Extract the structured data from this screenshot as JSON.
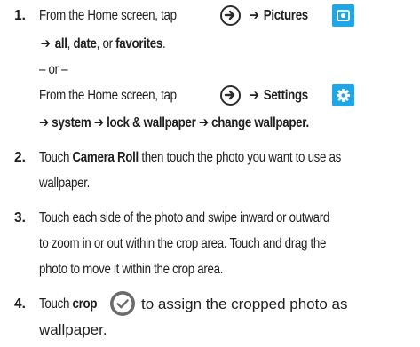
{
  "steps": [
    {
      "number": "1.",
      "line1_prefix": "From the Home screen, tap",
      "line1_target": "Pictures",
      "line2_arrow": "➔",
      "line2_opt1": "all",
      "line2_sep1": ", ",
      "line2_opt2": "date",
      "line2_sep2": ", or ",
      "line2_opt3": "favorites",
      "line2_end": ".",
      "or_text": "– or –",
      "line4_prefix": "From the Home screen, tap",
      "line4_target": "Settings",
      "line5_path": "➔ system ➔ lock & wallpaper ➔ change wallpaper."
    },
    {
      "number": "2.",
      "text_a": "Touch ",
      "text_bold": "Camera Roll",
      "text_b": " then touch the photo you want to use as",
      "text_line2": "wallpaper."
    },
    {
      "number": "3.",
      "line1": "Touch each side of the photo and swipe inward or outward",
      "line2": "to zoom in or out within the crop area. Touch and drag the",
      "line3": "photo to move it within the crop area."
    },
    {
      "number": "4.",
      "text_a": "Touch ",
      "text_bold": "crop",
      "text_b": "to assign the cropped photo as",
      "text_line2": "wallpaper."
    }
  ],
  "arrow_glyph": "➔",
  "icons": {
    "next": "circle-arrow-right-icon",
    "pictures": "pictures-tile-icon",
    "settings": "settings-gear-icon",
    "crop": "checkmark-circle-icon"
  },
  "colors": {
    "text": "#1f1f1f",
    "tile_blue": "#1ea7e8",
    "check_gray": "#6b6b6b"
  }
}
